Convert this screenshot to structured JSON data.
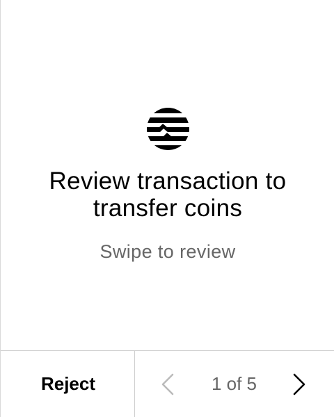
{
  "review": {
    "title_line1": "Review transaction to",
    "title_line2": "transfer coins",
    "subtitle": "Swipe to review"
  },
  "footer": {
    "reject_label": "Reject",
    "page_indicator": "1 of 5"
  },
  "icons": {
    "logo": "aptos-logo-icon",
    "prev": "chevron-left-icon",
    "next": "chevron-right-icon"
  },
  "colors": {
    "text_primary": "#000000",
    "text_secondary": "#666666",
    "prev_disabled": "#bbbbbb",
    "divider": "#cfcfcf"
  }
}
